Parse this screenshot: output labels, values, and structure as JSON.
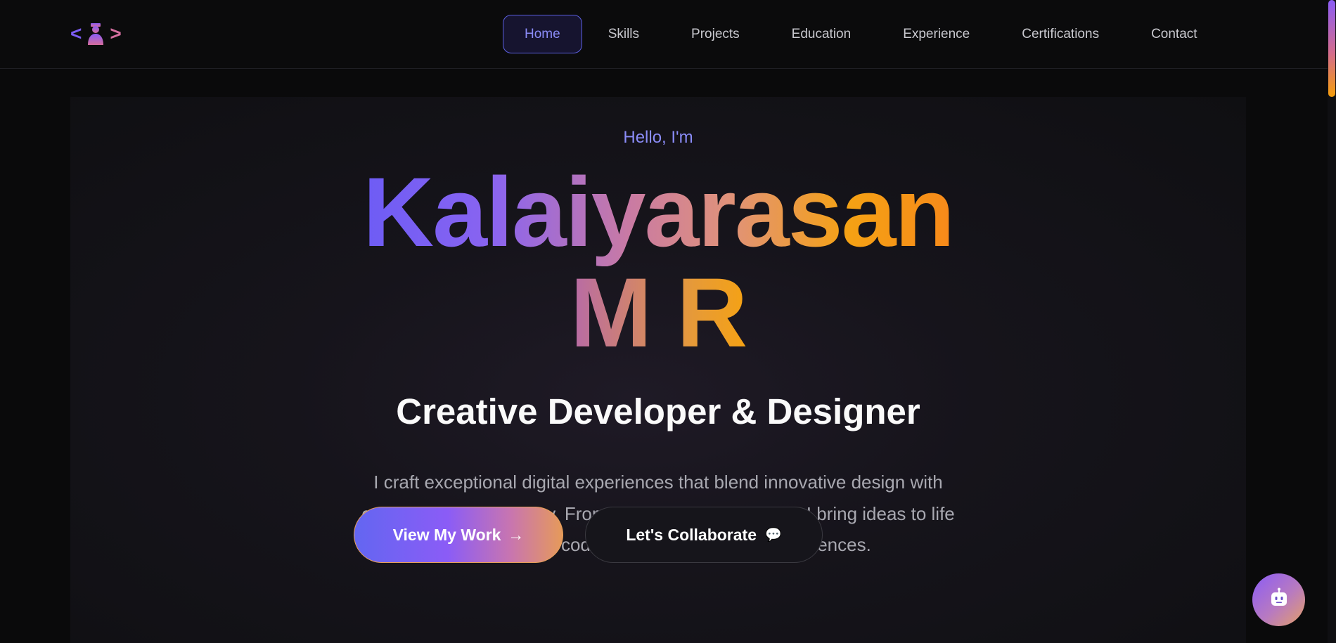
{
  "nav": {
    "logo": {
      "left_bracket": "<",
      "right_bracket": ">",
      "icon": "person-icon"
    },
    "items": [
      {
        "label": "Home",
        "active": true
      },
      {
        "label": "Skills",
        "active": false
      },
      {
        "label": "Projects",
        "active": false
      },
      {
        "label": "Education",
        "active": false
      },
      {
        "label": "Experience",
        "active": false
      },
      {
        "label": "Certifications",
        "active": false
      },
      {
        "label": "Contact",
        "active": false
      }
    ]
  },
  "hero": {
    "greeting": "Hello, I'm",
    "name_line1": "Kalaiyarasan",
    "name_line2": "M R",
    "role": "Creative Developer & Designer",
    "description": "I craft exceptional digital experiences that blend innovative design with cutting-edge technology. From concept to deployment, I bring ideas to life through clean code and thoughtful user experiences.",
    "primary_button": {
      "label": "View My Work",
      "arrow": "→"
    },
    "secondary_button": {
      "label": "Let's Collaborate",
      "icon": "speech-bubble-icon",
      "glyph": "💬"
    }
  },
  "chat_button": {
    "icon": "robot-icon"
  },
  "colors": {
    "accent_indigo": "#8b8cf8",
    "gradient_start": "#6d5cf5",
    "gradient_end": "#f7891a",
    "background": "#0a0a0b"
  }
}
